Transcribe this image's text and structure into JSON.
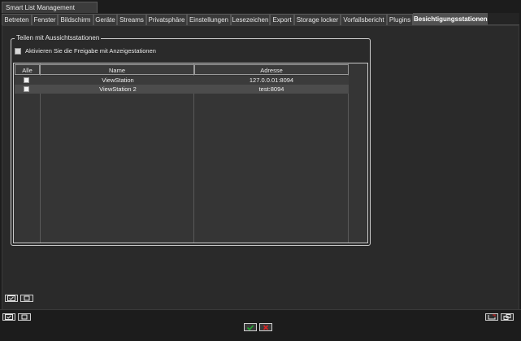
{
  "window": {
    "title": "Smart List Management"
  },
  "tabs": [
    {
      "label": "Betreten"
    },
    {
      "label": "Fenster"
    },
    {
      "label": "Bildschirm"
    },
    {
      "label": "Geräte"
    },
    {
      "label": "Streams"
    },
    {
      "label": "Privatsphäre"
    },
    {
      "label": "Einstellungen"
    },
    {
      "label": "Lesezeichen"
    },
    {
      "label": "Export"
    },
    {
      "label": "Storage locker"
    },
    {
      "label": "Vorfallsbericht"
    },
    {
      "label": "Plugins"
    },
    {
      "label": "Besichtigungsstationen",
      "active": true
    }
  ],
  "group": {
    "title": "Teilen mit Aussichtsstationen",
    "enable_label": "Aktivieren Sie die Freigabe mit Anzeigestationen",
    "enable_checked": false
  },
  "table": {
    "headers": {
      "all": "Alle",
      "name": "Name",
      "address": "Adresse"
    },
    "rows": [
      {
        "checked": false,
        "name": "ViewStation",
        "address": "127.0.0.01:8094"
      },
      {
        "checked": false,
        "name": "ViewStation 2",
        "address": "test:8094"
      }
    ]
  },
  "icons": {
    "select_all": "check-all-icon",
    "select_none": "uncheck-all-icon",
    "ok": "check-icon",
    "cancel": "x-icon",
    "restore": "restore-window-icon",
    "detach": "detach-window-icon"
  },
  "colors": {
    "ok": "#22aa33",
    "cancel": "#dd2222"
  }
}
